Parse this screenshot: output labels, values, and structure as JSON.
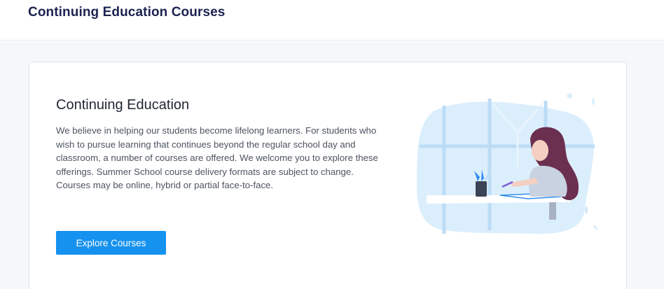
{
  "header": {
    "title": "Continuing Education Courses"
  },
  "card": {
    "heading": "Continuing Education",
    "body": "We believe in helping our students become lifelong learners. For students who wish to pursue learning that continues beyond the regular school day and classroom, a number of courses are offered. We welcome you to explore these offerings. Summer School course delivery formats are subject to change. Courses may be online, hybrid or partial face-to-face.",
    "button_label": "Explore Courses",
    "illustration_icon": "student-studying-illustration"
  },
  "colors": {
    "title": "#1b2350",
    "button": "#1592f0",
    "background": "#f6f7fa",
    "illustration_blue": "#dbeefc"
  }
}
